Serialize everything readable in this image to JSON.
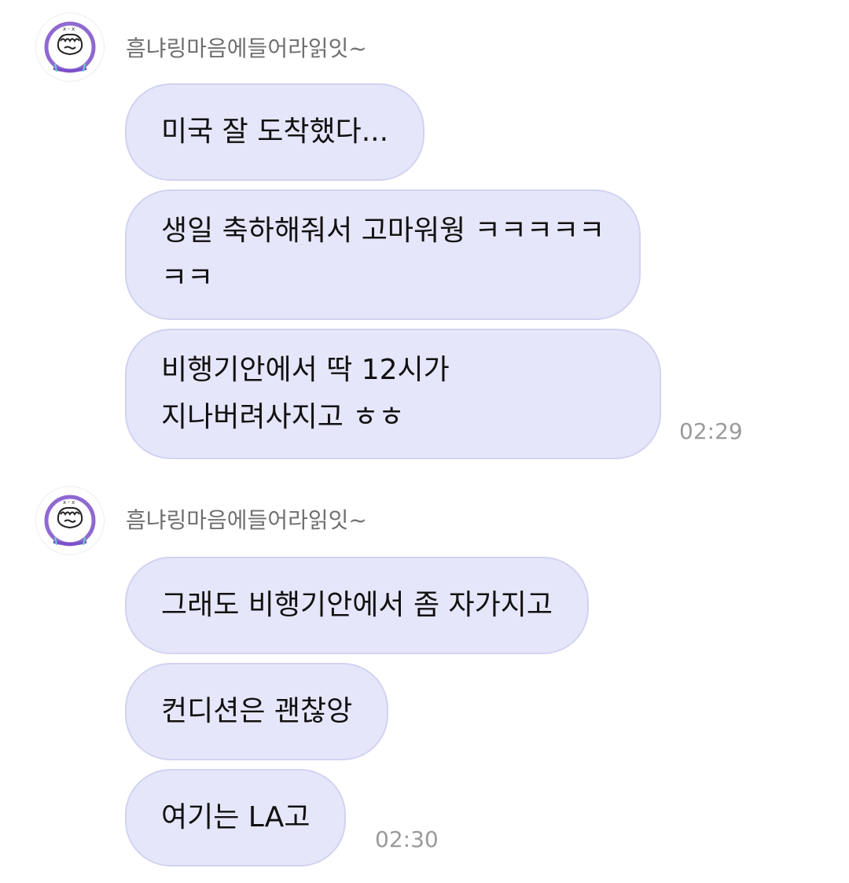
{
  "groups": [
    {
      "sender": "흠냐링마음에들어라읽잇~",
      "avatar_icon": "doodle-face-icon",
      "messages": [
        {
          "lines": [
            "미국 잘 도착했다..."
          ]
        },
        {
          "lines": [
            "생일 축하해줘서 고마워웡 ㅋㅋㅋㅋㅋ",
            "ㅋㅋ"
          ]
        },
        {
          "lines": [
            "비행기안에서 딱 12시가",
            "지나버려사지고 ㅎㅎ"
          ]
        }
      ],
      "time": "02:29"
    },
    {
      "sender": "흠냐링마음에들어라읽잇~",
      "avatar_icon": "doodle-face-icon",
      "messages": [
        {
          "lines": [
            "그래도 비행기안에서 좀 자가지고"
          ]
        },
        {
          "lines": [
            "컨디션은 괜찮앙"
          ]
        },
        {
          "lines": [
            "여기는 LA고"
          ]
        }
      ],
      "time": "02:30"
    }
  ],
  "colors": {
    "bubble_bg": "#e6e6fb",
    "bubble_border": "#d2d2f1",
    "avatar_stroke": "#7b4fc9",
    "text": "#111111",
    "sender_text": "#6f6f6f",
    "time_text": "#9a9a9a"
  }
}
